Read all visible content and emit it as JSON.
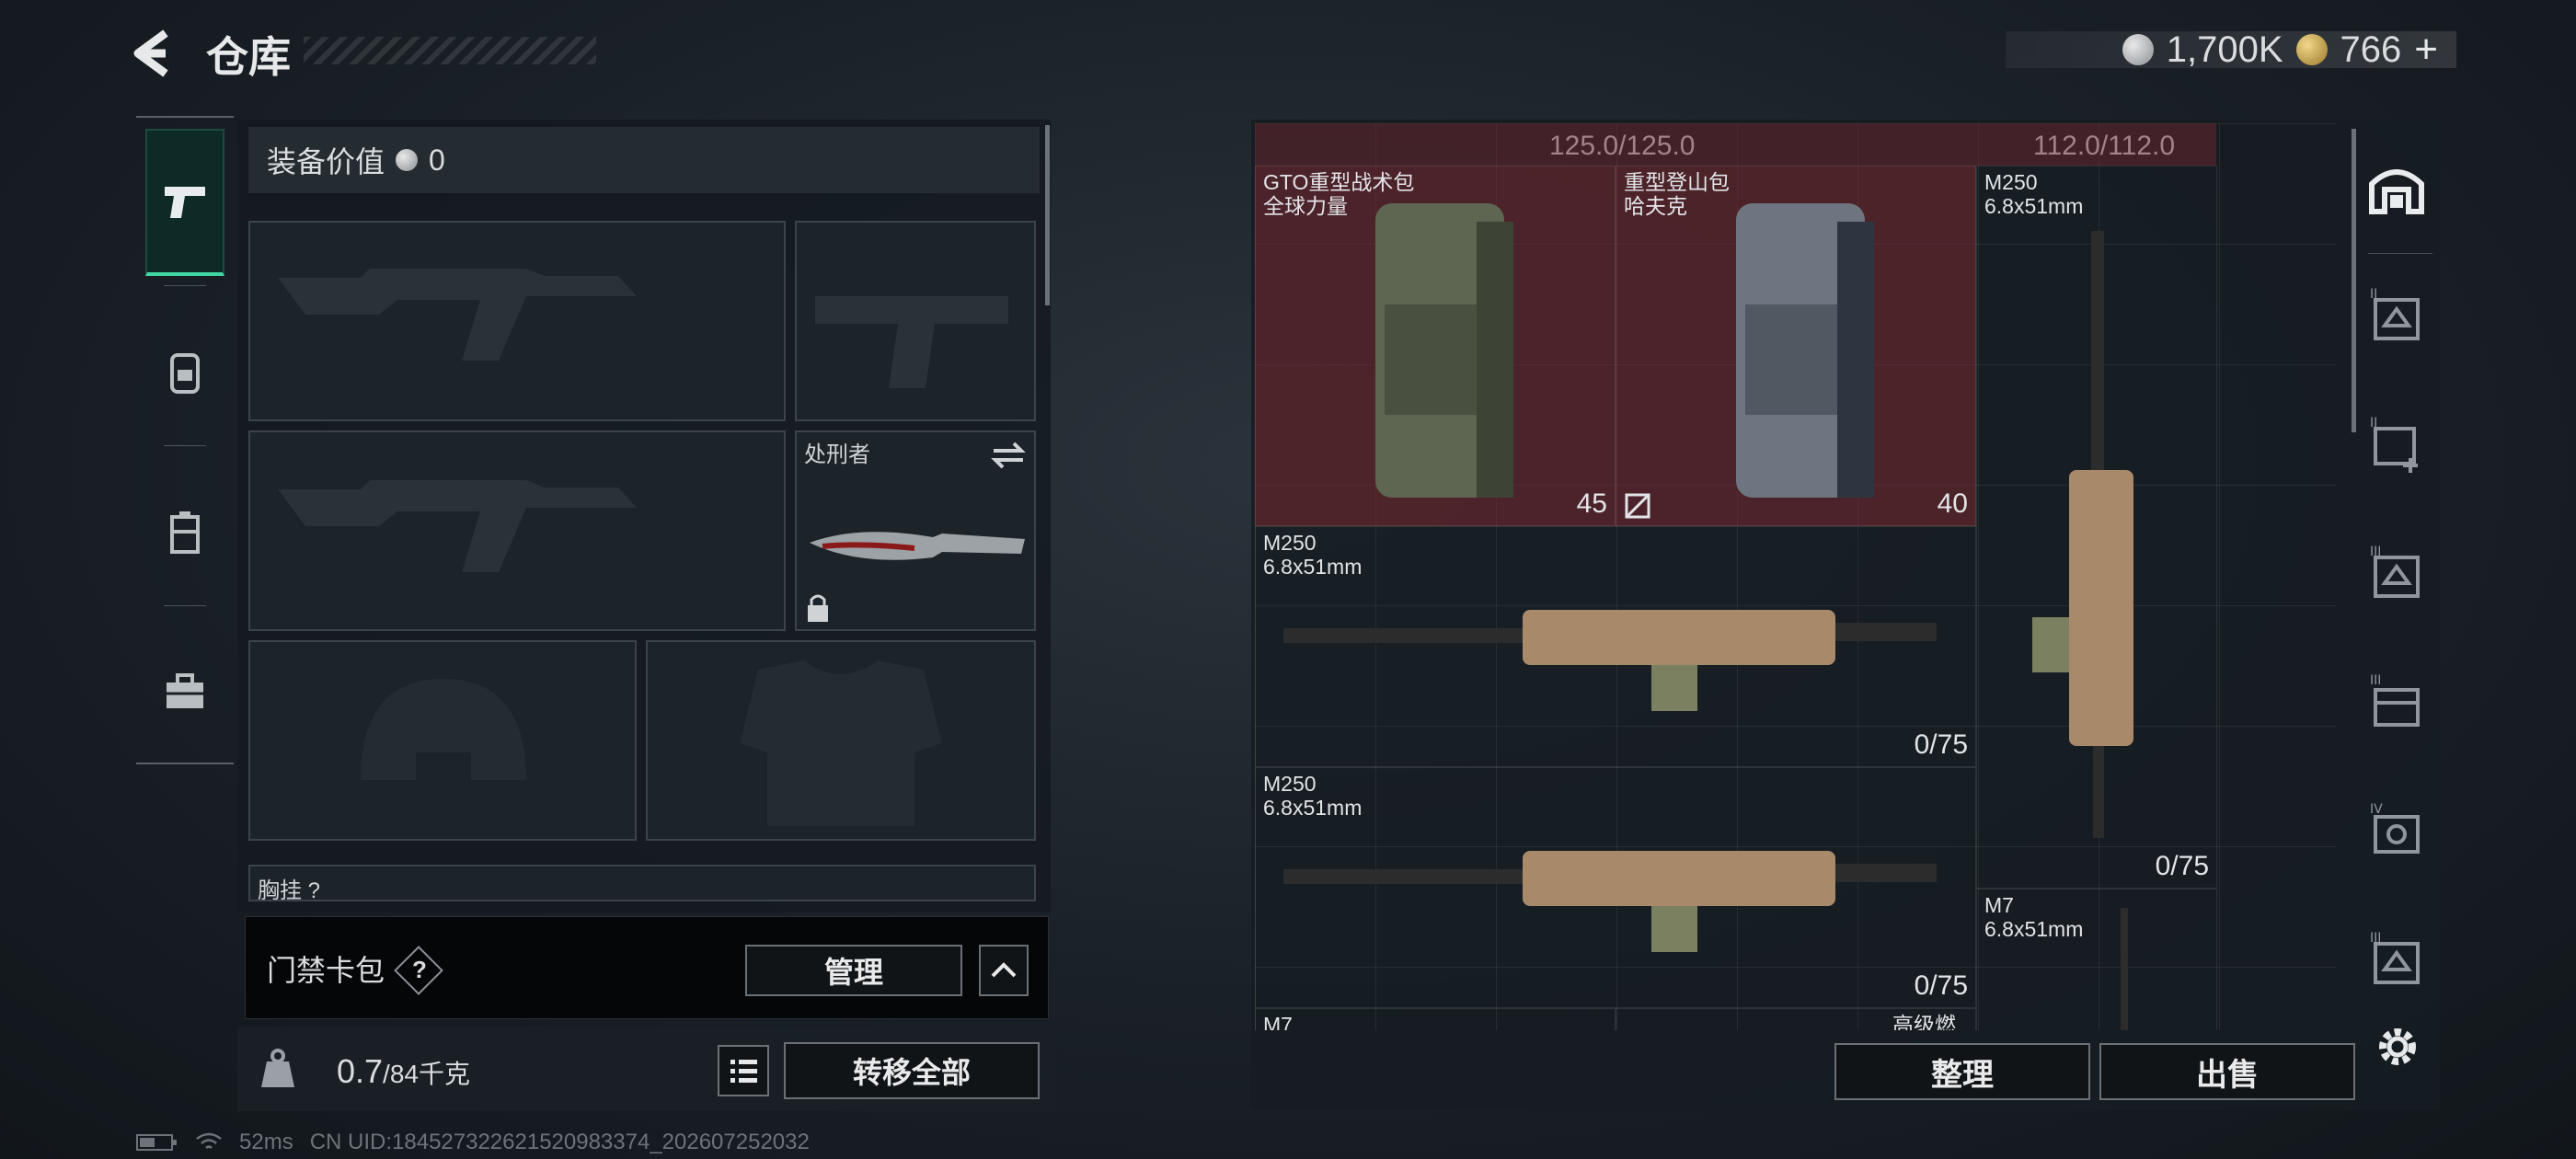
{
  "header": {
    "title": "仓库",
    "silver_amount": "1,700K",
    "gold_amount": "766",
    "plus": "+"
  },
  "loadout": {
    "value_label": "装备价值",
    "value": "0",
    "melee_name": "处刑者",
    "chest_rig_label": "胸挂",
    "chest_rig_hint": "?"
  },
  "access_card": {
    "label": "门禁卡包",
    "help": "?",
    "manage_label": "管理"
  },
  "bottom_left": {
    "weight": "0.7",
    "weight_max": "/84千克",
    "transfer_all_label": "转移全部"
  },
  "status": {
    "ping": "52ms",
    "uid": "CN UID:18452732262152098​3374_202607252032"
  },
  "inventory": {
    "capacity_1": "125.0/125.0",
    "capacity_2": "112.0/112.0",
    "items": [
      {
        "name": "GTO重型战术包",
        "sub": "全球力量",
        "count": "45"
      },
      {
        "name": "重型登山包",
        "sub": "哈夫克",
        "count": "40"
      },
      {
        "name": "M250",
        "sub": "6.8x51mm",
        "count": "0/75"
      },
      {
        "name": "M250",
        "sub": "6.8x51mm",
        "count": "0/75"
      },
      {
        "name": "M250",
        "sub": "6.8x51mm",
        "count": "0/75"
      },
      {
        "name": "M7",
        "sub": "6.8x51mm",
        "count": ""
      },
      {
        "name": "M7",
        "sub": "",
        "count": ""
      },
      {
        "name": "高级燃料",
        "sub": "",
        "count": ""
      }
    ],
    "sort_label": "整理",
    "sell_label": "出售"
  },
  "colors": {
    "accent": "#3fd6a0",
    "backpack_bg": "#782830"
  },
  "icons": {
    "back": "back-arrow-icon",
    "tabs": [
      "pistol-icon",
      "backpack-icon",
      "storage-case-icon",
      "briefcase-icon"
    ],
    "side": [
      "home-icon",
      "tier-ii-icon",
      "add-tier-ii-icon",
      "tier-iii-icon",
      "tier-iii-container-icon",
      "tier-iv-icon",
      "tier-iii-icon-2"
    ]
  }
}
